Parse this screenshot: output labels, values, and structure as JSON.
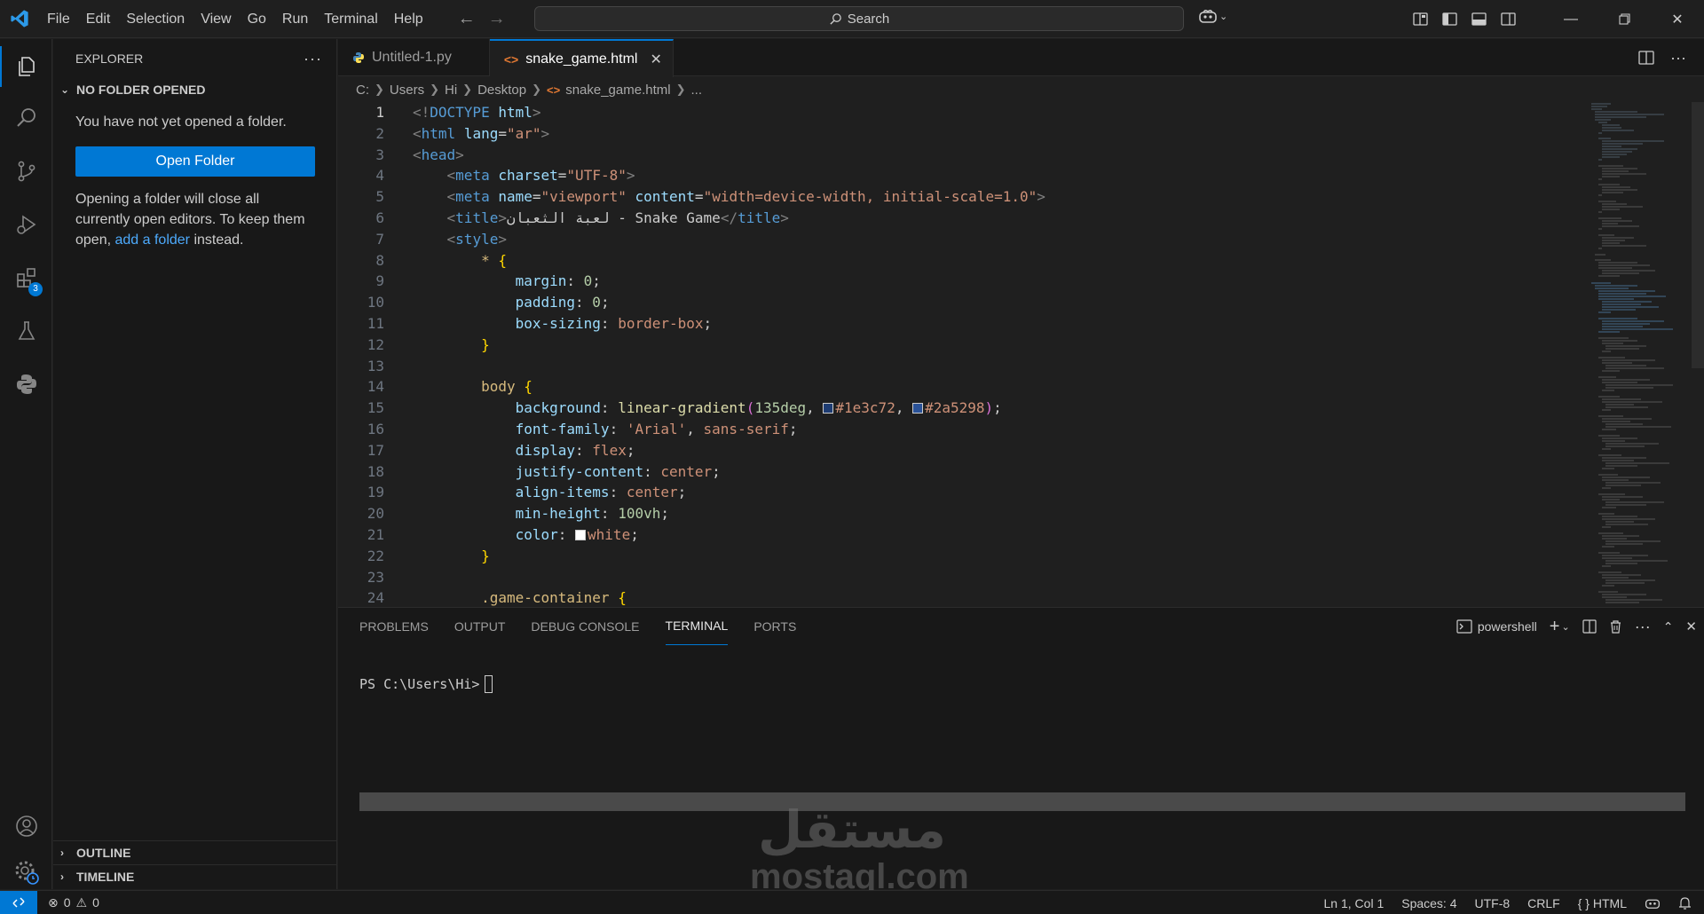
{
  "menu": [
    "File",
    "Edit",
    "Selection",
    "View",
    "Go",
    "Run",
    "Terminal",
    "Help"
  ],
  "search": {
    "label": "Search"
  },
  "sidebar": {
    "title": "EXPLORER",
    "section": "NO FOLDER OPENED",
    "message": "You have not yet opened a folder.",
    "open_button": "Open Folder",
    "note_before": "Opening a folder will close all currently open editors. To keep them open, ",
    "note_link": "add a folder",
    "note_after": " instead.",
    "outline": "OUTLINE",
    "timeline": "TIMELINE",
    "extensions_badge": "3"
  },
  "tabs": [
    {
      "label": "Untitled-1.py",
      "active": false
    },
    {
      "label": "snake_game.html",
      "active": true
    }
  ],
  "breadcrumb": [
    "C:",
    "Users",
    "Hi",
    "Desktop",
    "snake_game.html",
    "..."
  ],
  "code": {
    "line_numbers": [
      "1",
      "2",
      "3",
      "4",
      "5",
      "6",
      "7",
      "8",
      "9",
      "10",
      "11",
      "12",
      "13",
      "14",
      "15",
      "16",
      "17",
      "18",
      "19",
      "20",
      "21",
      "22",
      "23",
      "24"
    ],
    "l1": {
      "open": "<!",
      "kw": "DOCTYPE",
      "name": "html",
      "close": ">"
    },
    "l2": {
      "open": "<",
      "tag": "html",
      "attr": "lang",
      "eq": "=",
      "val": "\"ar\"",
      "close": ">"
    },
    "l3": {
      "open": "<",
      "tag": "head",
      "close": ">"
    },
    "l4": {
      "open": "<",
      "tag": "meta",
      "attr": "charset",
      "eq": "=",
      "val": "\"UTF-8\"",
      "close": ">"
    },
    "l5": {
      "open": "<",
      "tag": "meta",
      "attr1": "name",
      "eq": "=",
      "val1": "\"viewport\"",
      "attr2": "content",
      "val2": "\"width=device-width, initial-scale=1.0\"",
      "close": ">"
    },
    "l6": {
      "open": "<",
      "tag": "title",
      "close": ">",
      "text": "لعبة الثعبان - Snake Game",
      "end_open": "</",
      "end_close": ">"
    },
    "l7": {
      "open": "<",
      "tag": "style",
      "close": ">"
    },
    "l8": {
      "sel": "* ",
      "brace": "{"
    },
    "l9": {
      "prop": "margin",
      "colon": ": ",
      "num": "0",
      "semi": ";"
    },
    "l10": {
      "prop": "padding",
      "colon": ": ",
      "num": "0",
      "semi": ";"
    },
    "l11": {
      "prop": "box-sizing",
      "colon": ": ",
      "val": "border-box",
      "semi": ";"
    },
    "l12": {
      "brace": "}"
    },
    "l14": {
      "sel": "body ",
      "brace": "{"
    },
    "l15": {
      "prop": "background",
      "colon": ": ",
      "fn": "linear-gradient",
      "paren_open": "(",
      "num": "135deg",
      "comma": ", ",
      "c1": "#1e3c72",
      "c2": "#2a5298",
      "paren_close": ")",
      "semi": ";"
    },
    "l16": {
      "prop": "font-family",
      "colon": ": ",
      "str": "'Arial'",
      "comma": ", ",
      "val": "sans-serif",
      "semi": ";"
    },
    "l17": {
      "prop": "display",
      "colon": ": ",
      "val": "flex",
      "semi": ";"
    },
    "l18": {
      "prop": "justify-content",
      "colon": ": ",
      "val": "center",
      "semi": ";"
    },
    "l19": {
      "prop": "align-items",
      "colon": ": ",
      "val": "center",
      "semi": ";"
    },
    "l20": {
      "prop": "min-height",
      "colon": ": ",
      "num": "100vh",
      "semi": ";"
    },
    "l21": {
      "prop": "color",
      "colon": ": ",
      "val": "white",
      "semi": ";"
    },
    "l22": {
      "brace": "}"
    },
    "l24": {
      "sel": ".game-container ",
      "brace": "{"
    }
  },
  "panel": {
    "tabs": [
      "PROBLEMS",
      "OUTPUT",
      "DEBUG CONSOLE",
      "TERMINAL",
      "PORTS"
    ],
    "active_tab": "TERMINAL",
    "shell": "powershell",
    "prompt": "PS C:\\Users\\Hi>"
  },
  "watermark": {
    "arabic": "مستقل",
    "latin": "mostaql.com"
  },
  "status": {
    "errors": "0",
    "warnings": "0",
    "position": "Ln 1, Col 1",
    "spaces": "Spaces: 4",
    "encoding": "UTF-8",
    "eol": "CRLF",
    "language": "HTML",
    "language_icon": "{ }"
  },
  "colors": {
    "accent": "#0078d4",
    "swatch1": "#1e3c72",
    "swatch2": "#2a5298",
    "swatch3": "#ffffff"
  }
}
